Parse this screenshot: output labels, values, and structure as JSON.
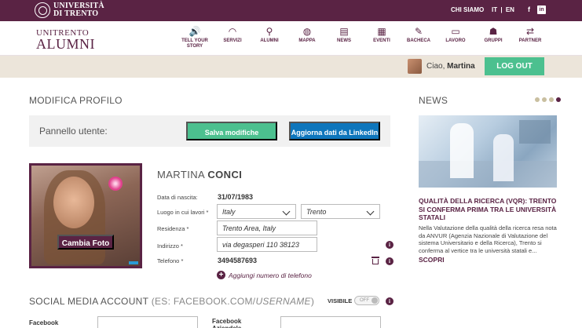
{
  "topbar": {
    "university": [
      "UNIVERSITÀ",
      "DI TRENTO"
    ],
    "chi_siamo": "CHI SIAMO",
    "lang_it": "IT",
    "lang_sep": "|",
    "lang_en": "EN",
    "facebook_glyph": "f",
    "linkedin_glyph": "in",
    "bg_color": "#5a2344"
  },
  "logo": {
    "line1": "UNITRENTO",
    "line2": "ALUMNI"
  },
  "nav": {
    "items": [
      {
        "label": "TELL YOUR STORY",
        "icon": "megaphone-icon",
        "glyph": "🔊"
      },
      {
        "label": "SERVIZI",
        "icon": "wifi-icon",
        "glyph": "◠"
      },
      {
        "label": "ALUMNI",
        "icon": "search-icon",
        "glyph": "⚲"
      },
      {
        "label": "MAPPA",
        "icon": "globe-icon",
        "glyph": "◍"
      },
      {
        "label": "NEWS",
        "icon": "chat-icon",
        "glyph": "▤"
      },
      {
        "label": "EVENTI",
        "icon": "calendar-icon",
        "glyph": "▦"
      },
      {
        "label": "BACHECA",
        "icon": "pushpin-icon",
        "glyph": "✎"
      },
      {
        "label": "LAVORO",
        "icon": "briefcase-icon",
        "glyph": "▭"
      },
      {
        "label": "GRUPPI",
        "icon": "group-icon",
        "glyph": "☗"
      },
      {
        "label": "PARTNER",
        "icon": "handshake-icon",
        "glyph": "⇄"
      }
    ]
  },
  "userbar": {
    "greeting": "Ciao,",
    "user_name": "Martina",
    "logout": "LOG OUT"
  },
  "profile": {
    "section_title": "MODIFICA PROFILO",
    "panel_label": "Pannello utente:",
    "save_btn": "Salva modifiche",
    "linkedin_btn": "Aggiorna dati da LinkedIn",
    "change_photo": "Cambia Foto",
    "first_name": "MARTINA",
    "last_name": "CONCI",
    "fields": {
      "birth_label": "Data di nascita:",
      "birth_value": "31/07/1983",
      "work_label": "Luogo in cui lavori *",
      "work_country": "Italy",
      "work_city": "Trento",
      "residence_label": "Residenza *",
      "residence_value": "Trento Area, Italy",
      "address_label": "Indirizzo *",
      "address_value": "via degasperi 110 38123",
      "phone_label": "Telefono *",
      "phone_value": "3494587693",
      "add_phone": "Aggiungi numero di telefono"
    },
    "info_glyph": "i",
    "plus_glyph": "+"
  },
  "social": {
    "title_main": "SOCIAL MEDIA ACCOUNT",
    "title_hint": "(ES: FACEBOOK.COM/",
    "title_hint_em": "USERNAME",
    "title_hint_end": ")",
    "visible_label": "VISIBILE",
    "toggle_text": "OFF",
    "visible_on": false,
    "facebook_label": "Facebook",
    "facebook_aziendale_label": "Facebook Aziendale"
  },
  "news": {
    "title": "NEWS",
    "slides": 4,
    "active_slide": 4,
    "headline": "QUALITÀ DELLA RICERCA (VQR): TRENTO SI CONFERMA PRIMA TRA LE UNIVERSITÀ STATALI",
    "text": "Nella Valutazione della qualità della ricerca resa nota da ANVUR (Agenzia Nazionale di Valutazione del sistema Universitario e della Ricerca), Trento si conferma al vertice tra le università statali e...",
    "more": "SCOPRI"
  }
}
